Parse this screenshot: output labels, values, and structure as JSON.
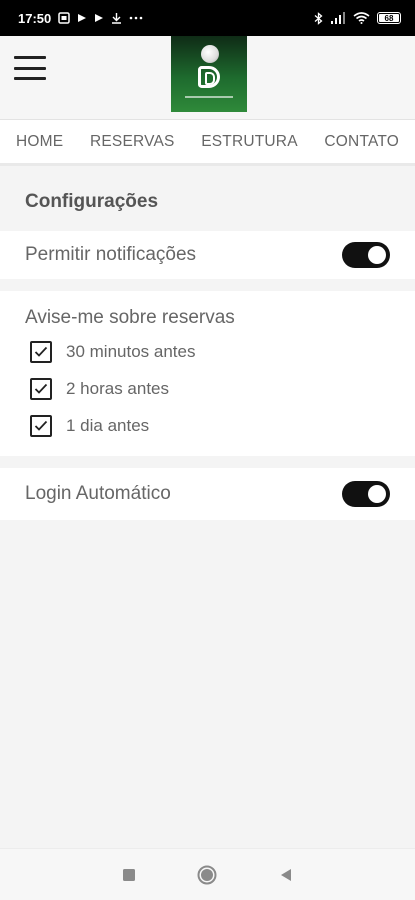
{
  "status_bar": {
    "time": "17:50",
    "icons": [
      "sim-card-icon",
      "play-store-icon",
      "play-icon",
      "download-icon",
      "more-dots-icon",
      "bluetooth-icon",
      "signal-icon",
      "wifi-icon",
      "battery-icon"
    ],
    "battery_level": "68"
  },
  "header": {
    "menu_icon": "hamburger-menu-icon",
    "logo": "club-logo"
  },
  "nav_tabs": [
    {
      "label": "HOME"
    },
    {
      "label": "RESERVAS"
    },
    {
      "label": "ESTRUTURA"
    },
    {
      "label": "CONTATO"
    }
  ],
  "settings": {
    "title": "Configurações",
    "notifications": {
      "label": "Permitir notificações",
      "enabled": true
    },
    "reminders": {
      "title": "Avise-me sobre reservas",
      "options": [
        {
          "label": "30 minutos antes",
          "checked": true
        },
        {
          "label": "2 horas antes",
          "checked": true
        },
        {
          "label": "1 dia antes",
          "checked": true
        }
      ]
    },
    "auto_login": {
      "label": "Login Automático",
      "enabled": true
    }
  },
  "android_nav": [
    "recent-apps-icon",
    "home-icon",
    "back-icon"
  ],
  "colors": {
    "toggle_on": "#111111",
    "tab_text": "#666666",
    "background": "#f4f4f4"
  }
}
